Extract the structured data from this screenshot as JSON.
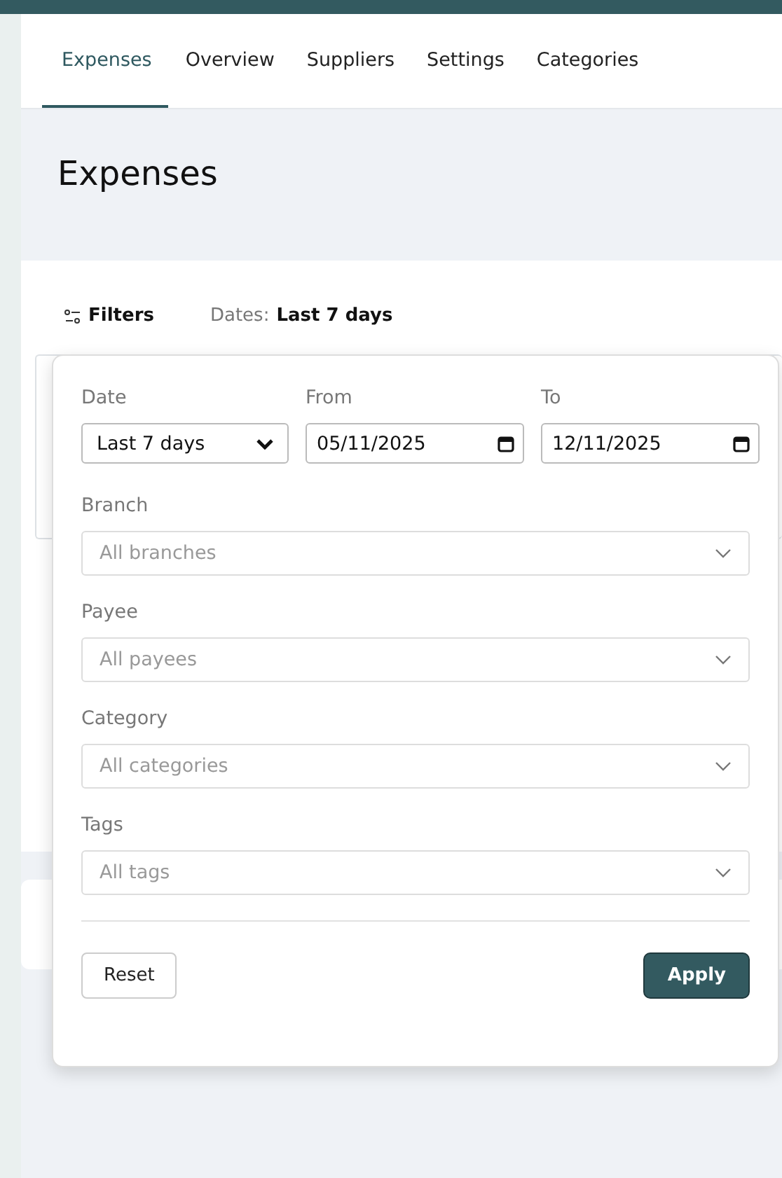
{
  "tabs": [
    {
      "label": "Expenses",
      "selected": true
    },
    {
      "label": "Overview",
      "selected": false
    },
    {
      "label": "Suppliers",
      "selected": false
    },
    {
      "label": "Settings",
      "selected": false
    },
    {
      "label": "Categories",
      "selected": false
    }
  ],
  "page_title": "Expenses",
  "filter_bar": {
    "filters_button": "Filters",
    "dates_label": "Dates:",
    "dates_value": "Last 7 days"
  },
  "filter_panel": {
    "date": {
      "label": "Date",
      "value": "Last 7 days"
    },
    "from": {
      "label": "From",
      "value": "05/11/2025"
    },
    "to": {
      "label": "To",
      "value": "12/11/2025"
    },
    "selects": [
      {
        "label": "Branch",
        "placeholder": "All branches"
      },
      {
        "label": "Payee",
        "placeholder": "All payees"
      },
      {
        "label": "Category",
        "placeholder": "All categories"
      },
      {
        "label": "Tags",
        "placeholder": "All tags"
      }
    ],
    "reset": "Reset",
    "apply": "Apply"
  }
}
